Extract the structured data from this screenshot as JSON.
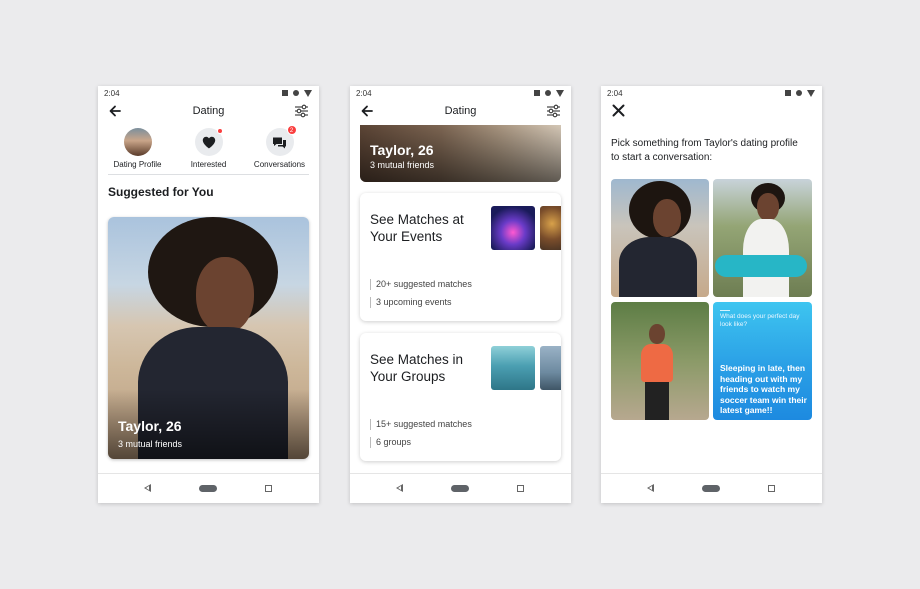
{
  "status": {
    "time": "2:04"
  },
  "screen1": {
    "title": "Dating",
    "shortcuts": [
      {
        "label": "Dating Profile"
      },
      {
        "label": "Interested"
      },
      {
        "label": "Conversations",
        "badge": "2"
      }
    ],
    "section_title": "Suggested for You",
    "profile": {
      "name": "Taylor, 26",
      "mutual": "3 mutual friends"
    }
  },
  "screen2": {
    "title": "Dating",
    "profile": {
      "name": "Taylor, 26",
      "mutual": "3 mutual friends"
    },
    "cards": [
      {
        "title": "See Matches at Your Events",
        "stat1": "20+ suggested matches",
        "stat2": "3 upcoming events"
      },
      {
        "title": "See Matches in Your Groups",
        "stat1": "15+ suggested matches",
        "stat2": "6 groups"
      }
    ]
  },
  "screen3": {
    "prompt": "Pick something from Taylor's dating profile to start a conversation:",
    "question": "What does your perfect day look like?",
    "answer": "Sleeping in late, then heading out with my friends to watch my soccer team win their latest game!!"
  },
  "icons": {
    "back": "back-arrow-icon",
    "filter": "filter-sliders-icon",
    "close": "close-icon",
    "heart": "heart-icon",
    "chat": "chat-bubbles-icon"
  },
  "colors": {
    "notification_red": "#fa3e3e",
    "answer_card_blue": "#2a9fe6",
    "background": "#ebebed"
  }
}
